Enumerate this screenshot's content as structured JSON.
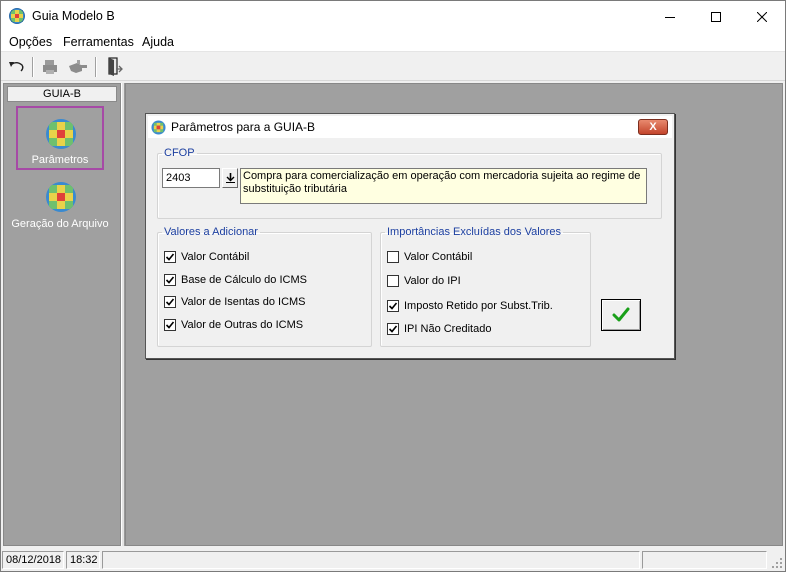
{
  "window": {
    "title": "Guia Modelo B",
    "icon": "globe-app-icon",
    "controls": [
      "minimize-icon",
      "maximize-icon",
      "close-icon"
    ]
  },
  "menu": {
    "items": [
      {
        "label": "Opções"
      },
      {
        "label": "Ferramentas"
      },
      {
        "label": "Ajuda"
      }
    ]
  },
  "toolbar": {
    "buttons": [
      "undo-icon",
      "print-icon",
      "hand-icon",
      "exit-door-icon"
    ]
  },
  "sidebar": {
    "header": "GUIA-B",
    "items": [
      {
        "label": "Parâmetros",
        "icon": "globe-icon",
        "selected": true
      },
      {
        "label": "Geração do Arquivo",
        "icon": "globe-icon",
        "selected": false
      }
    ]
  },
  "dialog": {
    "title": "Parâmetros para a GUIA-B",
    "close_label": "X",
    "cfop": {
      "legend": "CFOP",
      "code": "2403",
      "description": "Compra para comercialização em operação com mercadoria sujeita ao regime de substituição tributária"
    },
    "valores_adicionar": {
      "legend": "Valores a Adicionar",
      "items": [
        {
          "label": "Valor Contábil",
          "checked": true
        },
        {
          "label": "Base de Cálculo do ICMS",
          "checked": true
        },
        {
          "label": "Valor de Isentas do ICMS",
          "checked": true
        },
        {
          "label": "Valor de Outras do ICMS",
          "checked": true
        }
      ]
    },
    "importancias_excluidas": {
      "legend": "Importâncias Excluídas dos Valores",
      "items": [
        {
          "label": "Valor Contábil",
          "checked": false
        },
        {
          "label": "Valor do IPI",
          "checked": false
        },
        {
          "label": "Imposto Retido por Subst.Trib.",
          "checked": true
        },
        {
          "label": "IPI Não Creditado",
          "checked": true
        }
      ]
    },
    "ok_button_icon": "green-checkmark-icon",
    "accent_color": "#1c3fa0"
  },
  "statusbar": {
    "date": "08/12/2018",
    "time": "18:32"
  }
}
